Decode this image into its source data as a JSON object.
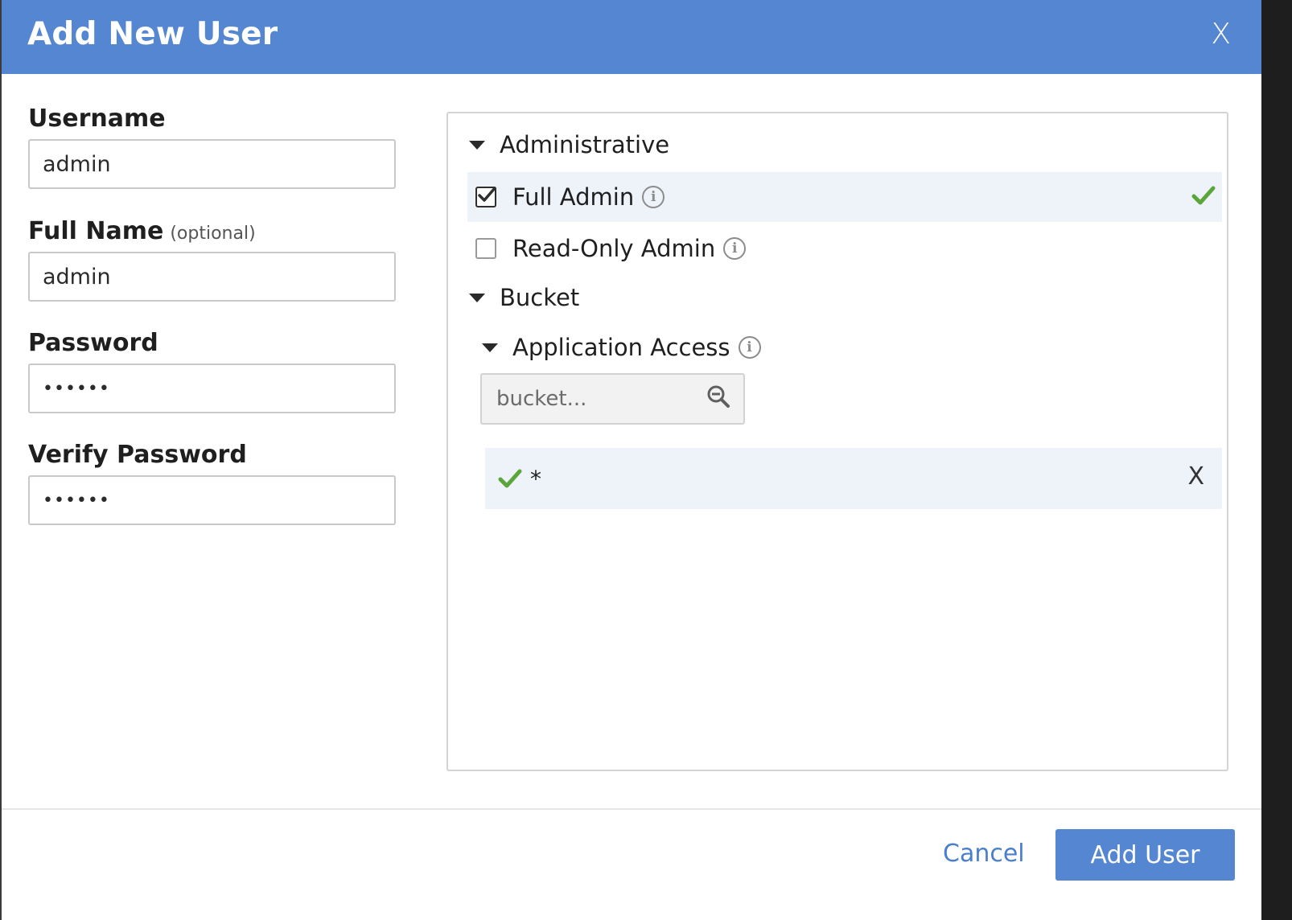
{
  "dialog": {
    "title": "Add New User",
    "close_label": "X"
  },
  "form": {
    "username": {
      "label": "Username",
      "value": "admin"
    },
    "full_name": {
      "label": "Full Name",
      "optional_note": "(optional)",
      "value": "admin"
    },
    "password": {
      "label": "Password",
      "value": "••••••"
    },
    "verify_password": {
      "label": "Verify Password",
      "value": "••••••"
    }
  },
  "permissions": {
    "administrative": {
      "label": "Administrative",
      "items": [
        {
          "label": "Full Admin",
          "checked": true,
          "selected": true
        },
        {
          "label": "Read-Only Admin",
          "checked": false,
          "selected": false
        }
      ]
    },
    "bucket": {
      "label": "Bucket",
      "application_access": {
        "label": "Application Access",
        "search_placeholder": "bucket...",
        "entries": [
          {
            "value": "*",
            "remove_label": "X"
          }
        ]
      }
    }
  },
  "footer": {
    "cancel_label": "Cancel",
    "submit_label": "Add User"
  },
  "colors": {
    "header": "#5486d2",
    "accent_link": "#4a7fce",
    "check_green": "#5aa63a",
    "selected_row": "#eef2f9"
  },
  "icons": {
    "close": "close-icon",
    "info": "info-icon",
    "expand": "caret-down-icon",
    "check": "checkmark-icon",
    "search": "search-zoom-out-icon"
  }
}
